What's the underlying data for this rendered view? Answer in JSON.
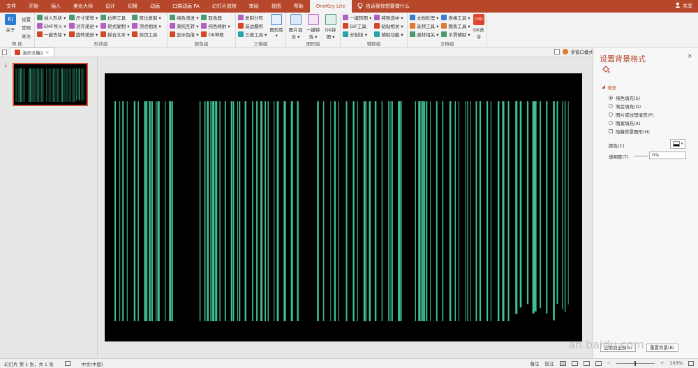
{
  "colors": {
    "accent": "#b7472a",
    "stripe": "#3fbf95",
    "slide_bg": "#000000"
  },
  "tabs": [
    "文件",
    "开始",
    "插入",
    "美化大师",
    "设计",
    "切换",
    "动画",
    "口袋动画 PA",
    "幻灯片放映",
    "审阅",
    "视图",
    "帮助",
    "OneKey Lite"
  ],
  "active_tab_index": 12,
  "tell_me": "告诉我你想要做什么",
  "share": "共享",
  "ribbon": {
    "help_group": {
      "items": [
        "关于",
        "设置",
        "官网",
        "关注"
      ],
      "name": "帮 助"
    },
    "shape_group": {
      "col1": [
        "插入形状 ▾",
        "EMF导入 ▾",
        "一键去除 ▾"
      ],
      "col2": [
        "尺寸递增 ▾",
        "对齐递进 ▾",
        "旋转递进 ▾"
      ],
      "col3": [
        "拉伸工具",
        "矩式复制 ▾",
        "拆合文本 ▾"
      ],
      "col4": [
        "原位复制 ▾",
        "顶点相关 ▾",
        "跨页工具"
      ],
      "name": "形状组"
    },
    "color_group": {
      "col1": [
        "纯色递进 ▾",
        "渐纯互转 ▾",
        "显示色值 ▾"
      ],
      "col2": [
        "取色器",
        "纯色映射 ▾",
        "OK神框"
      ],
      "name": "颜色组"
    },
    "threed_group": {
      "col1": [
        "复制分布",
        "演边叠积",
        "三维工具 ▾"
      ],
      "big": "图形库 ▾",
      "name": "三维组"
    },
    "image_group": {
      "big": [
        "图片混合 ▾",
        "一键特效 ▾",
        "OK拼图 ▾"
      ],
      "name": "图形组"
    },
    "assist_group": {
      "col1": [
        "一键转图 ▾",
        "GIF工具",
        "分割线 ▾"
      ],
      "col2": [
        "特殊选中 ▾",
        "粘贴相关 ▾",
        "辅助功能 ▾"
      ],
      "name": "辅助组"
    },
    "doc_group": {
      "col1": [
        "文档处理 ▾",
        "音频工具 ▾",
        "道材相关 ▾"
      ],
      "col2": [
        "表格工具 ▾",
        "图表工具 ▾",
        "平滑辅助 ▾"
      ],
      "big": "OK命令",
      "cmd": "CMD",
      "name": "文档组"
    }
  },
  "doc_tab": "演示文稿1",
  "doc_tab_close": "×",
  "doc_right": "多窗口模式",
  "thumb_number": "1",
  "pane": {
    "title": "设置背景格式",
    "close": "×",
    "section": "填充",
    "options": [
      {
        "label": "纯色填充(S)",
        "selected": true
      },
      {
        "label": "渐变填充(G)",
        "selected": false
      },
      {
        "label": "图片或纹理填充(P)",
        "selected": false
      },
      {
        "label": "图案填充(A)",
        "selected": false
      }
    ],
    "hide_bg": "隐藏背景图形(H)",
    "color_label": "颜色(C)",
    "transparency_label": "透明度(T)",
    "transparency_value": "0%",
    "apply_all": "应用到全部(L)",
    "reset": "重置背景(B)"
  },
  "status": {
    "slide_info": "幻灯片 第 1 张，共 1 张",
    "language": "中文(中国)",
    "notes": "备注",
    "comments": "批注",
    "zoom": "103%"
  },
  "watermark": "an.baidu.com"
}
